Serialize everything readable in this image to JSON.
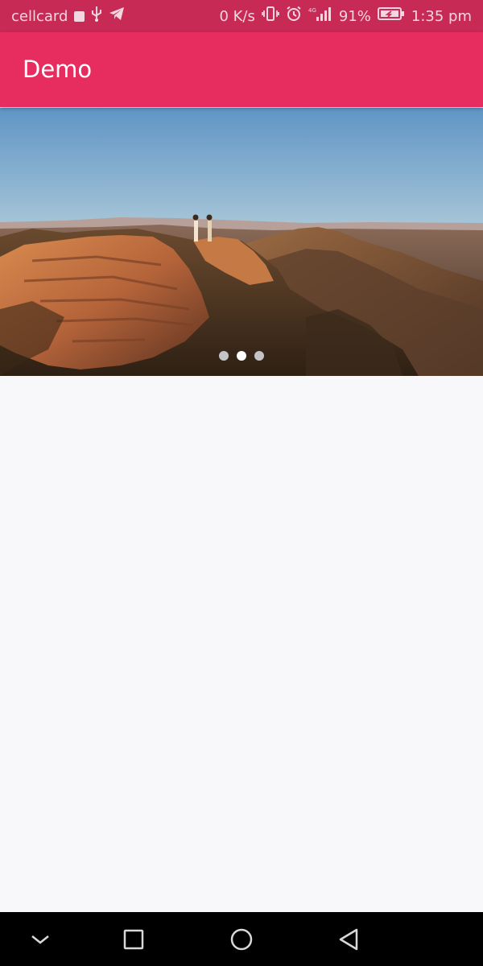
{
  "status_bar": {
    "carrier": "cellcard",
    "network_speed": "0 K/s",
    "battery_percent": "91%",
    "time": "1:35 pm",
    "icons": [
      "stop-icon",
      "usb-icon",
      "telegram-icon",
      "vibrate-icon",
      "alarm-icon",
      "signal-icon",
      "battery-charging-icon"
    ]
  },
  "app_bar": {
    "title": "Demo",
    "background": "#e72c5f"
  },
  "carousel": {
    "image_alt": "Two hikers on a rocky summit overlooking a mountain range at sunset",
    "slide_count": 3,
    "active_index": 1
  },
  "nav_bar": {
    "buttons": [
      "collapse-icon",
      "recents-icon",
      "home-icon",
      "back-icon"
    ]
  }
}
